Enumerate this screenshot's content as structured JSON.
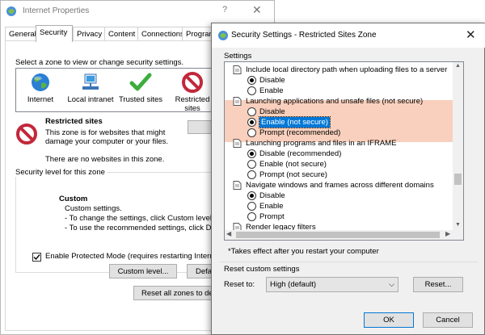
{
  "internet_properties": {
    "title": "Internet Properties",
    "help_glyph": "?",
    "close_glyph": "✕",
    "tabs": [
      "General",
      "Security",
      "Privacy",
      "Content",
      "Connections",
      "Program"
    ],
    "active_tab": "Security",
    "instruction": "Select a zone to view or change security settings.",
    "zones": [
      {
        "label": "Internet",
        "icon": "globe-icon"
      },
      {
        "label": "Local intranet",
        "icon": "intranet-icon"
      },
      {
        "label": "Trusted sites",
        "icon": "checkmark-icon"
      },
      {
        "label": "Restricted sites",
        "icon": "restricted-icon",
        "selected": true
      }
    ],
    "zone_heading": "Restricted sites",
    "zone_desc_1": "This zone is for websites that might",
    "zone_desc_2": "damage your computer or your files.",
    "zone_note": "There are no websites in this zone.",
    "security_level_label": "Security level for this zone",
    "custom_heading": "Custom",
    "custom_lines": [
      "Custom settings.",
      "- To change the settings, click Custom level.",
      "- To use the recommended settings, click Defa"
    ],
    "protected_mode": "Enable Protected Mode (requires restarting Internet E",
    "protected_mode_checked": true,
    "custom_level_button": "Custom level...",
    "default_button": "Defa",
    "reset_all_button": "Reset all zones to defa"
  },
  "security_settings": {
    "title": "Security Settings - Restricted Sites Zone",
    "close_glyph": "✕",
    "settings_label": "Settings",
    "rows": [
      {
        "kind": "category",
        "text": "Include local directory path when uploading files to a server"
      },
      {
        "kind": "option",
        "text": "Disable",
        "checked": true
      },
      {
        "kind": "option",
        "text": "Enable",
        "checked": false
      },
      {
        "kind": "category",
        "text": "Launching applications and unsafe files (not secure)"
      },
      {
        "kind": "option",
        "text": "Disable",
        "checked": false
      },
      {
        "kind": "option",
        "text": "Enable (not secure)",
        "checked": true,
        "selected": true
      },
      {
        "kind": "option",
        "text": "Prompt (recommended)",
        "checked": false
      },
      {
        "kind": "category",
        "text": "Launching programs and files in an IFRAME"
      },
      {
        "kind": "option",
        "text": "Disable (recommended)",
        "checked": true
      },
      {
        "kind": "option",
        "text": "Enable (not secure)",
        "checked": false
      },
      {
        "kind": "option",
        "text": "Prompt (not secure)",
        "checked": false
      },
      {
        "kind": "category",
        "text": "Navigate windows and frames across different domains"
      },
      {
        "kind": "option",
        "text": "Disable",
        "checked": true
      },
      {
        "kind": "option",
        "text": "Enable",
        "checked": false
      },
      {
        "kind": "option",
        "text": "Prompt",
        "checked": false
      },
      {
        "kind": "category",
        "text": "Render legacy filters"
      }
    ],
    "footnote": "*Takes effect after you restart your computer",
    "reset_group_label": "Reset custom settings",
    "reset_to_label": "Reset to:",
    "reset_to_value": "High (default)",
    "reset_button": "Reset...",
    "ok_button": "OK",
    "cancel_button": "Cancel",
    "highlight_color": "#f9d0bd",
    "selection_color": "#0078d7"
  }
}
